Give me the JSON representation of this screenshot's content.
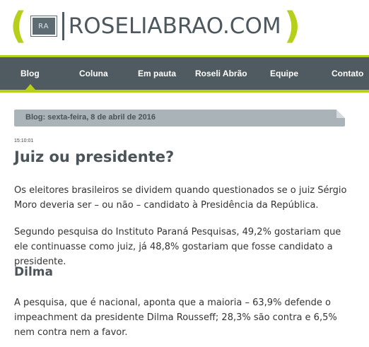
{
  "site": {
    "logo_badge": "RA",
    "logo_text": "ROSELIABRAO.COM"
  },
  "nav": {
    "items": [
      {
        "label": "Blog"
      },
      {
        "label": "Coluna"
      },
      {
        "label": "Em pauta"
      },
      {
        "label": "Roseli Abrão"
      },
      {
        "label": "Equipe"
      },
      {
        "label": "Contato"
      }
    ],
    "active": "Blog"
  },
  "date_bar": {
    "text": "Blog: sexta-feira, 8 de abril de 2016"
  },
  "article": {
    "time": "15:10:01",
    "title": "Juiz ou presidente?",
    "p1": "Os eleitores brasileiros se dividem quando questionados se o juiz Sérgio Moro deveria ser – ou não – candidato à Presidência da República.",
    "p2": "Segundo pesquisa do Instituto Paraná Pesquisas, 49,2% gostariam que ele continuasse como juiz, já 48,8% gostariam que fosse candidato a presidente.",
    "subhead": "Dilma",
    "p3": "A pesquisa, que é nacional, aponta que a maioria – 63,9% defende o impeachment da presidente Dilma Rousseff; 28,3% são contra e 6,5% nem contra nem a favor."
  },
  "colors": {
    "accent": "#b5cf1a",
    "nav_bg": "#4f5b61",
    "date_bar_bg": "#a9b3b8"
  }
}
